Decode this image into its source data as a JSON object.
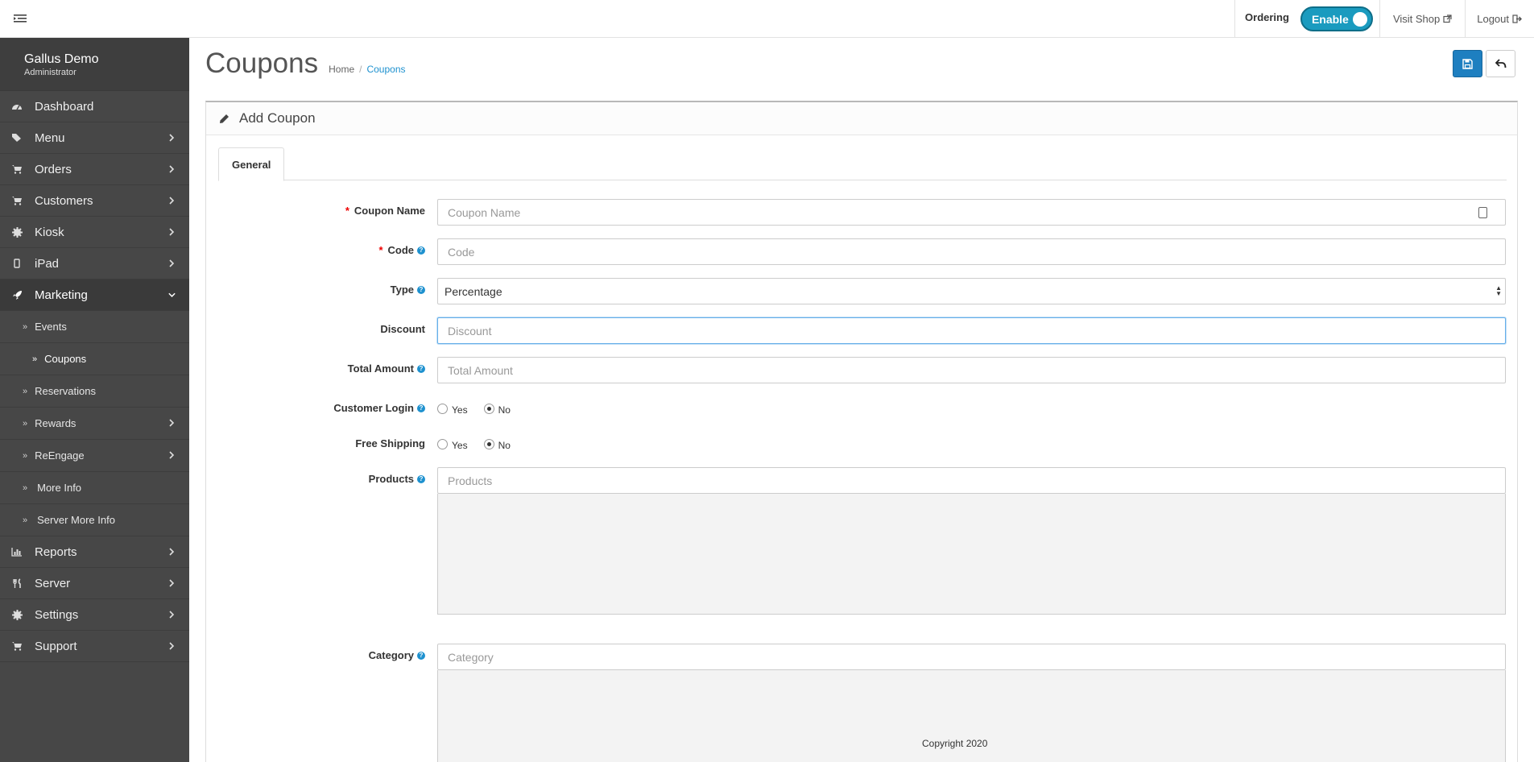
{
  "topbar": {
    "ordering_label": "Ordering",
    "ordering_toggle": "Enable",
    "visit_shop": "Visit Shop",
    "logout": "Logout"
  },
  "profile": {
    "name": "Gallus Demo",
    "role": "Administrator"
  },
  "sidebar": {
    "items": [
      {
        "label": "Dashboard",
        "icon": "dashboard-icon"
      },
      {
        "label": "Menu",
        "icon": "tags-icon"
      },
      {
        "label": "Orders",
        "icon": "cart-icon"
      },
      {
        "label": "Customers",
        "icon": "cart-icon"
      },
      {
        "label": "Kiosk",
        "icon": "gear-icon"
      },
      {
        "label": "iPad",
        "icon": "mobile-icon"
      },
      {
        "label": "Marketing",
        "icon": "rocket-icon"
      }
    ],
    "marketing_sub": [
      {
        "label": "Events"
      },
      {
        "label": "Coupons"
      },
      {
        "label": "Reservations"
      },
      {
        "label": "Rewards"
      },
      {
        "label": "ReEngage"
      },
      {
        "label": "More Info"
      },
      {
        "label": "Server More Info"
      }
    ],
    "items_after": [
      {
        "label": "Reports",
        "icon": "bar-chart-icon"
      },
      {
        "label": "Server",
        "icon": "cutlery-icon"
      },
      {
        "label": "Settings",
        "icon": "gear-icon"
      },
      {
        "label": "Support",
        "icon": "cart-icon"
      }
    ]
  },
  "page": {
    "title": "Coupons",
    "breadcrumb_home": "Home",
    "breadcrumb_sep": "/",
    "breadcrumb_current": "Coupons",
    "panel_title": "Add Coupon",
    "tab_general": "General"
  },
  "form": {
    "coupon_name_label": "Coupon Name",
    "coupon_name_placeholder": "Coupon Name",
    "code_label": "Code",
    "code_placeholder": "Code",
    "type_label": "Type",
    "type_value": "Percentage",
    "discount_label": "Discount",
    "discount_placeholder": "Discount",
    "total_amount_label": "Total Amount",
    "total_amount_placeholder": "Total Amount",
    "customer_login_label": "Customer Login",
    "free_shipping_label": "Free Shipping",
    "yes": "Yes",
    "no": "No",
    "products_label": "Products",
    "products_placeholder": "Products",
    "category_label": "Category",
    "category_placeholder": "Category"
  },
  "footer": {
    "copyright": "Copyright 2020"
  },
  "colors": {
    "accent": "#1e91cf",
    "toggle": "#1a9bbf",
    "sidebar": "#474747",
    "required": "#ee0000"
  }
}
